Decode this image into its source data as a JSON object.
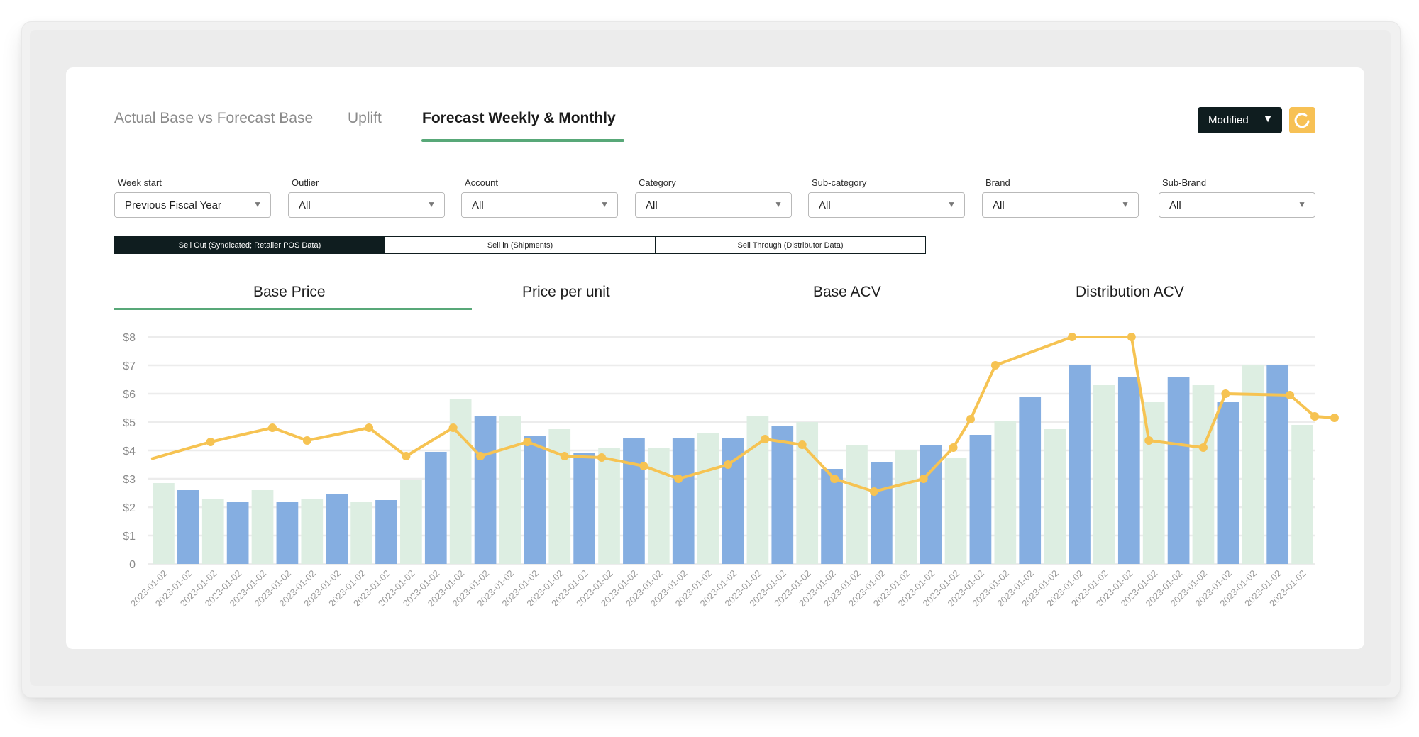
{
  "tabs": [
    {
      "label": "Actual Base vs Forecast Base"
    },
    {
      "label": "Uplift"
    },
    {
      "label": "Forecast Weekly & Monthly"
    }
  ],
  "active_tab": 2,
  "mode_button": {
    "label": "Modified"
  },
  "filters": [
    {
      "label": "Week start",
      "value": "Previous Fiscal Year"
    },
    {
      "label": "Outlier",
      "value": "All"
    },
    {
      "label": "Account",
      "value": "All"
    },
    {
      "label": "Category",
      "value": "All"
    },
    {
      "label": "Sub-category",
      "value": "All"
    },
    {
      "label": "Brand",
      "value": "All"
    },
    {
      "label": "Sub-Brand",
      "value": "All"
    }
  ],
  "data_sources": [
    {
      "label": "Sell Out (Syndicated; Retailer POS Data)"
    },
    {
      "label": "Sell in (Shipments)"
    },
    {
      "label": "Sell Through (Distributor Data)"
    }
  ],
  "metric_tabs": [
    {
      "label": "Base Price"
    },
    {
      "label": "Price per unit"
    },
    {
      "label": "Base ACV"
    },
    {
      "label": "Distribution ACV"
    }
  ],
  "colors": {
    "bar_blue": "#85aee1",
    "bar_green": "#ddeee2",
    "line": "#f6c352",
    "accent_green": "#58a878",
    "dark": "#0f1d1f",
    "refresh": "#f7c155"
  },
  "chart_data": {
    "type": "bar",
    "ylim": [
      0,
      8
    ],
    "ytick_labels": [
      "0",
      "$1",
      "$2",
      "$3",
      "$4",
      "$5",
      "$6",
      "$7",
      "$8"
    ],
    "grid": true,
    "categories": [
      "2023-01-02",
      "2023-01-02",
      "2023-01-02",
      "2023-01-02",
      "2023-01-02",
      "2023-01-02",
      "2023-01-02",
      "2023-01-02",
      "2023-01-02",
      "2023-01-02",
      "2023-01-02",
      "2023-01-02",
      "2023-01-02",
      "2023-01-02",
      "2023-01-02",
      "2023-01-02",
      "2023-01-02",
      "2023-01-02",
      "2023-01-02",
      "2023-01-02",
      "2023-01-02",
      "2023-01-02",
      "2023-01-02",
      "2023-01-02",
      "2023-01-02",
      "2023-01-02",
      "2023-01-02",
      "2023-01-02",
      "2023-01-02",
      "2023-01-02",
      "2023-01-02",
      "2023-01-02",
      "2023-01-02",
      "2023-01-02",
      "2023-01-02",
      "2023-01-02",
      "2023-01-02",
      "2023-01-02",
      "2023-01-02",
      "2023-01-02",
      "2023-01-02",
      "2023-01-02",
      "2023-01-02",
      "2023-01-02",
      "2023-01-02",
      "2023-01-02",
      "2023-01-02"
    ],
    "bar_values": [
      2.85,
      2.6,
      2.3,
      2.2,
      2.6,
      2.2,
      2.3,
      2.45,
      2.2,
      2.25,
      2.95,
      3.95,
      5.8,
      5.2,
      5.2,
      4.5,
      4.75,
      3.9,
      4.1,
      4.45,
      4.1,
      4.45,
      4.6,
      4.45,
      5.2,
      4.85,
      5.0,
      3.35,
      4.2,
      3.6,
      4.0,
      4.2,
      3.75,
      4.55,
      5.05,
      5.9,
      4.75,
      7.0,
      6.3,
      6.6,
      5.7,
      6.6,
      6.3,
      5.7,
      7.0,
      7.0,
      4.9
    ],
    "bar_color_pattern": [
      "green",
      "blue",
      "green",
      "blue",
      "green",
      "blue",
      "green",
      "blue",
      "green",
      "blue",
      "green",
      "blue",
      "green",
      "blue",
      "green",
      "blue",
      "green",
      "blue",
      "green",
      "blue",
      "green",
      "blue",
      "green",
      "blue",
      "green",
      "blue",
      "green",
      "blue",
      "green",
      "blue",
      "green",
      "blue",
      "green",
      "blue",
      "green",
      "blue",
      "green",
      "blue",
      "green",
      "blue",
      "green",
      "blue",
      "green",
      "blue",
      "green",
      "blue",
      "green"
    ],
    "line_x": [
      0,
      2.4,
      4.9,
      6.3,
      8.8,
      10.3,
      12.2,
      13.3,
      15.2,
      16.7,
      18.2,
      19.9,
      21.3,
      23.3,
      24.8,
      26.3,
      27.6,
      29.2,
      31.2,
      32.4,
      33.1,
      34.1,
      37.2,
      39.6,
      40.3,
      42.5,
      43.4,
      46.0,
      47.0,
      47.8
    ],
    "line_values": [
      3.7,
      4.3,
      4.8,
      4.35,
      4.8,
      3.8,
      4.8,
      3.8,
      4.3,
      3.8,
      3.75,
      3.45,
      3.0,
      3.5,
      4.4,
      4.2,
      3.0,
      2.55,
      3.0,
      4.1,
      5.1,
      7.0,
      8.0,
      8.0,
      4.35,
      4.1,
      6.0,
      5.95,
      5.2,
      5.15
    ],
    "line_markers_to": 29
  }
}
